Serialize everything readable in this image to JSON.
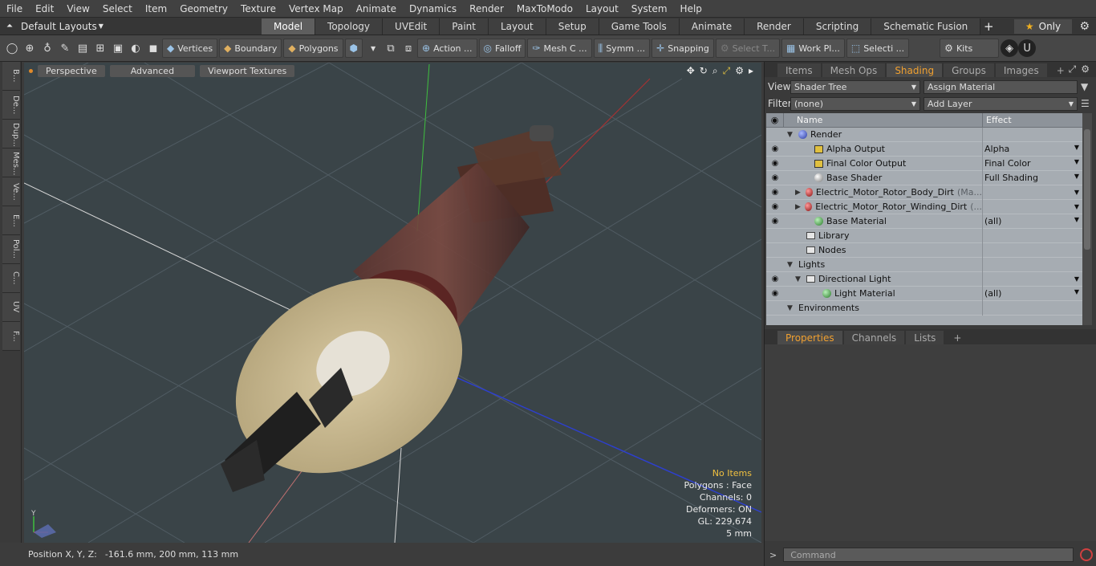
{
  "menu": [
    "File",
    "Edit",
    "View",
    "Select",
    "Item",
    "Geometry",
    "Texture",
    "Vertex Map",
    "Animate",
    "Dynamics",
    "Render",
    "MaxToModo",
    "Layout",
    "System",
    "Help"
  ],
  "layout_selector": "Default Layouts",
  "mode_tabs": [
    {
      "label": "Model",
      "active": true
    },
    {
      "label": "Topology"
    },
    {
      "label": "UVEdit"
    },
    {
      "label": "Paint"
    },
    {
      "label": "Layout"
    },
    {
      "label": "Setup"
    },
    {
      "label": "Game Tools"
    },
    {
      "label": "Animate"
    },
    {
      "label": "Render"
    },
    {
      "label": "Scripting"
    },
    {
      "label": "Schematic Fusion"
    }
  ],
  "only_label": "Only",
  "toolbar": {
    "vertices": "Vertices",
    "boundary": "Boundary",
    "polygons": "Polygons",
    "action": "Action ...",
    "falloff": "Falloff",
    "mesh": "Mesh C ...",
    "symm": "Symm ...",
    "snapping": "Snapping",
    "select_t": "Select T...",
    "work_pl": "Work Pl...",
    "selecti": "Selecti ...",
    "kits": "Kits"
  },
  "left_strip": [
    "B...",
    "De...",
    "Dup...",
    "Mes...",
    "Ve...",
    "E...",
    "Pol...",
    "C...",
    "UV",
    "F..."
  ],
  "viewport": {
    "buttons": [
      "Perspective",
      "Advanced",
      "Viewport Textures"
    ],
    "info": {
      "items": "No Items",
      "polygons": "Polygons : Face",
      "channels": "Channels: 0",
      "deformers": "Deformers: ON",
      "gl": "GL: 229,674",
      "scale": "5 mm"
    },
    "axis_y": "Y"
  },
  "status": {
    "label": "Position X, Y, Z:",
    "value": "-161.6 mm, 200 mm, 113 mm"
  },
  "right": {
    "tabs": [
      {
        "label": "Items"
      },
      {
        "label": "Mesh Ops"
      },
      {
        "label": "Shading",
        "active": true
      },
      {
        "label": "Groups"
      },
      {
        "label": "Images"
      }
    ],
    "view_label": "View",
    "view_value": "Shader Tree",
    "assign": "Assign Material",
    "filter_label": "Filter",
    "filter_value": "(none)",
    "add_layer": "Add Layer",
    "col_name": "Name",
    "col_effect": "Effect",
    "tree": [
      {
        "name": "Render",
        "effect": "",
        "icon": "blue",
        "indent": 0,
        "eye": false,
        "expand": "▼"
      },
      {
        "name": "Alpha Output",
        "effect": "Alpha",
        "icon": "img",
        "indent": 2,
        "eye": true
      },
      {
        "name": "Final Color Output",
        "effect": "Final Color",
        "icon": "img",
        "indent": 2,
        "eye": true
      },
      {
        "name": "Base Shader",
        "effect": "Full Shading",
        "icon": "white",
        "indent": 2,
        "eye": true
      },
      {
        "name": "Electric_Motor_Rotor_Body_Dirt",
        "suffix": "(Ma...",
        "effect": "",
        "icon": "red",
        "indent": 1,
        "eye": true,
        "expand": "▶"
      },
      {
        "name": "Electric_Motor_Rotor_Winding_Dirt",
        "suffix": "(...",
        "effect": "",
        "icon": "red",
        "indent": 1,
        "eye": true,
        "expand": "▶"
      },
      {
        "name": "Base Material",
        "effect": "(all)",
        "icon": "green",
        "indent": 2,
        "eye": true
      },
      {
        "name": "Library",
        "effect": "",
        "icon": "folder",
        "indent": 1,
        "eye": false
      },
      {
        "name": "Nodes",
        "effect": "",
        "icon": "folder",
        "indent": 1,
        "eye": false
      },
      {
        "name": "Lights",
        "effect": "",
        "icon": "",
        "indent": 0,
        "eye": false,
        "expand": "▼"
      },
      {
        "name": "Directional Light",
        "effect": "",
        "icon": "light",
        "indent": 1,
        "eye": true,
        "expand": "▼"
      },
      {
        "name": "Light Material",
        "effect": "(all)",
        "icon": "green",
        "indent": 3,
        "eye": true
      },
      {
        "name": "Environments",
        "effect": "",
        "icon": "",
        "indent": 0,
        "eye": false,
        "expand": "▼"
      }
    ],
    "prop_tabs": [
      {
        "label": "Properties",
        "active": true
      },
      {
        "label": "Channels"
      },
      {
        "label": "Lists"
      }
    ],
    "command_placeholder": "Command"
  }
}
